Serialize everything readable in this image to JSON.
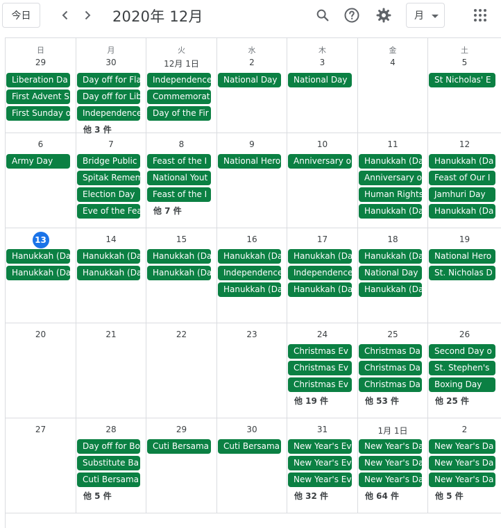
{
  "toolbar": {
    "today_label": "今日",
    "title": "2020年 12月",
    "view_label": "月"
  },
  "colors": {
    "event": "#0b8043",
    "today": "#1a73e8"
  },
  "icons": [
    "chevron-left-icon",
    "chevron-right-icon",
    "search-icon",
    "help-icon",
    "gear-icon",
    "caret-down-icon",
    "apps-grid-icon"
  ],
  "weekdays": [
    "日",
    "月",
    "火",
    "水",
    "木",
    "金",
    "土"
  ],
  "weeks": [
    {
      "days": [
        {
          "label": "29",
          "events": [
            "Liberation Da",
            "First Advent S",
            "First Sunday o"
          ],
          "more": ""
        },
        {
          "label": "30",
          "events": [
            "Day off for Fla",
            "Day off for Lib",
            "Independence"
          ],
          "more": "他 3 件"
        },
        {
          "label": "12月 1日",
          "events": [
            "Independence",
            "Commemorat",
            "Day of the Fir"
          ],
          "more": ""
        },
        {
          "label": "2",
          "events": [
            "National Day"
          ],
          "more": ""
        },
        {
          "label": "3",
          "events": [
            "National Day"
          ],
          "more": ""
        },
        {
          "label": "4",
          "events": [],
          "more": ""
        },
        {
          "label": "5",
          "events": [
            "St Nicholas' E"
          ],
          "more": ""
        }
      ]
    },
    {
      "days": [
        {
          "label": "6",
          "events": [
            "Army Day"
          ],
          "more": ""
        },
        {
          "label": "7",
          "events": [
            "Bridge Public",
            "Spitak Remem",
            "Election Day",
            "Eve of the Fea"
          ],
          "more": ""
        },
        {
          "label": "8",
          "events": [
            "Feast of the I",
            "National Yout",
            "Feast of the I"
          ],
          "more": "他 7 件"
        },
        {
          "label": "9",
          "events": [
            "National Hero"
          ],
          "more": ""
        },
        {
          "label": "10",
          "events": [
            "Anniversary o"
          ],
          "more": ""
        },
        {
          "label": "11",
          "events": [
            "Hanukkah (Da",
            "Anniversary o",
            "Human Rights",
            "Hanukkah (Da"
          ],
          "more": ""
        },
        {
          "label": "12",
          "events": [
            "Hanukkah (Da",
            "Feast of Our I",
            "Jamhuri Day",
            "Hanukkah (Da"
          ],
          "more": ""
        }
      ]
    },
    {
      "days": [
        {
          "label": "13",
          "today": true,
          "events": [
            "Hanukkah (Da",
            "Hanukkah (Da"
          ],
          "more": ""
        },
        {
          "label": "14",
          "events": [
            "Hanukkah (Da",
            "Hanukkah (Da"
          ],
          "more": ""
        },
        {
          "label": "15",
          "events": [
            "Hanukkah (Da",
            "Hanukkah (Da"
          ],
          "more": ""
        },
        {
          "label": "16",
          "events": [
            "Hanukkah (Da",
            "Independence",
            "Hanukkah (Da"
          ],
          "more": ""
        },
        {
          "label": "17",
          "events": [
            "Hanukkah (Da",
            "Independence",
            "Hanukkah (Da"
          ],
          "more": ""
        },
        {
          "label": "18",
          "events": [
            "Hanukkah (Da",
            "National Day",
            "Hanukkah (Da"
          ],
          "more": ""
        },
        {
          "label": "19",
          "events": [
            "National Hero",
            "St. Nicholas D"
          ],
          "more": ""
        }
      ]
    },
    {
      "days": [
        {
          "label": "20",
          "events": [],
          "more": ""
        },
        {
          "label": "21",
          "events": [],
          "more": ""
        },
        {
          "label": "22",
          "events": [],
          "more": ""
        },
        {
          "label": "23",
          "events": [],
          "more": ""
        },
        {
          "label": "24",
          "events": [
            "Christmas Ev",
            "Christmas Ev",
            "Christmas Ev"
          ],
          "more": "他 19 件"
        },
        {
          "label": "25",
          "events": [
            "Christmas Da",
            "Christmas Da",
            "Christmas Da"
          ],
          "more": "他 53 件"
        },
        {
          "label": "26",
          "events": [
            "Second Day o",
            "St. Stephen's",
            "Boxing Day"
          ],
          "more": "他 25 件"
        }
      ]
    },
    {
      "days": [
        {
          "label": "27",
          "events": [],
          "more": ""
        },
        {
          "label": "28",
          "events": [
            "Day off for Bo",
            "Substitute Ba",
            "Cuti Bersama"
          ],
          "more": "他 5 件"
        },
        {
          "label": "29",
          "events": [
            "Cuti Bersama"
          ],
          "more": ""
        },
        {
          "label": "30",
          "events": [
            "Cuti Bersama"
          ],
          "more": ""
        },
        {
          "label": "31",
          "events": [
            "New Year's Ev",
            "New Year's Ev",
            "New Year's Ev"
          ],
          "more": "他 32 件"
        },
        {
          "label": "1月 1日",
          "events": [
            "New Year's Da",
            "New Year's Da",
            "New Year's Da"
          ],
          "more": "他 64 件"
        },
        {
          "label": "2",
          "events": [
            "New Year's Da",
            "New Year's Da",
            "New Year's Da"
          ],
          "more": "他 5 件"
        }
      ]
    }
  ]
}
